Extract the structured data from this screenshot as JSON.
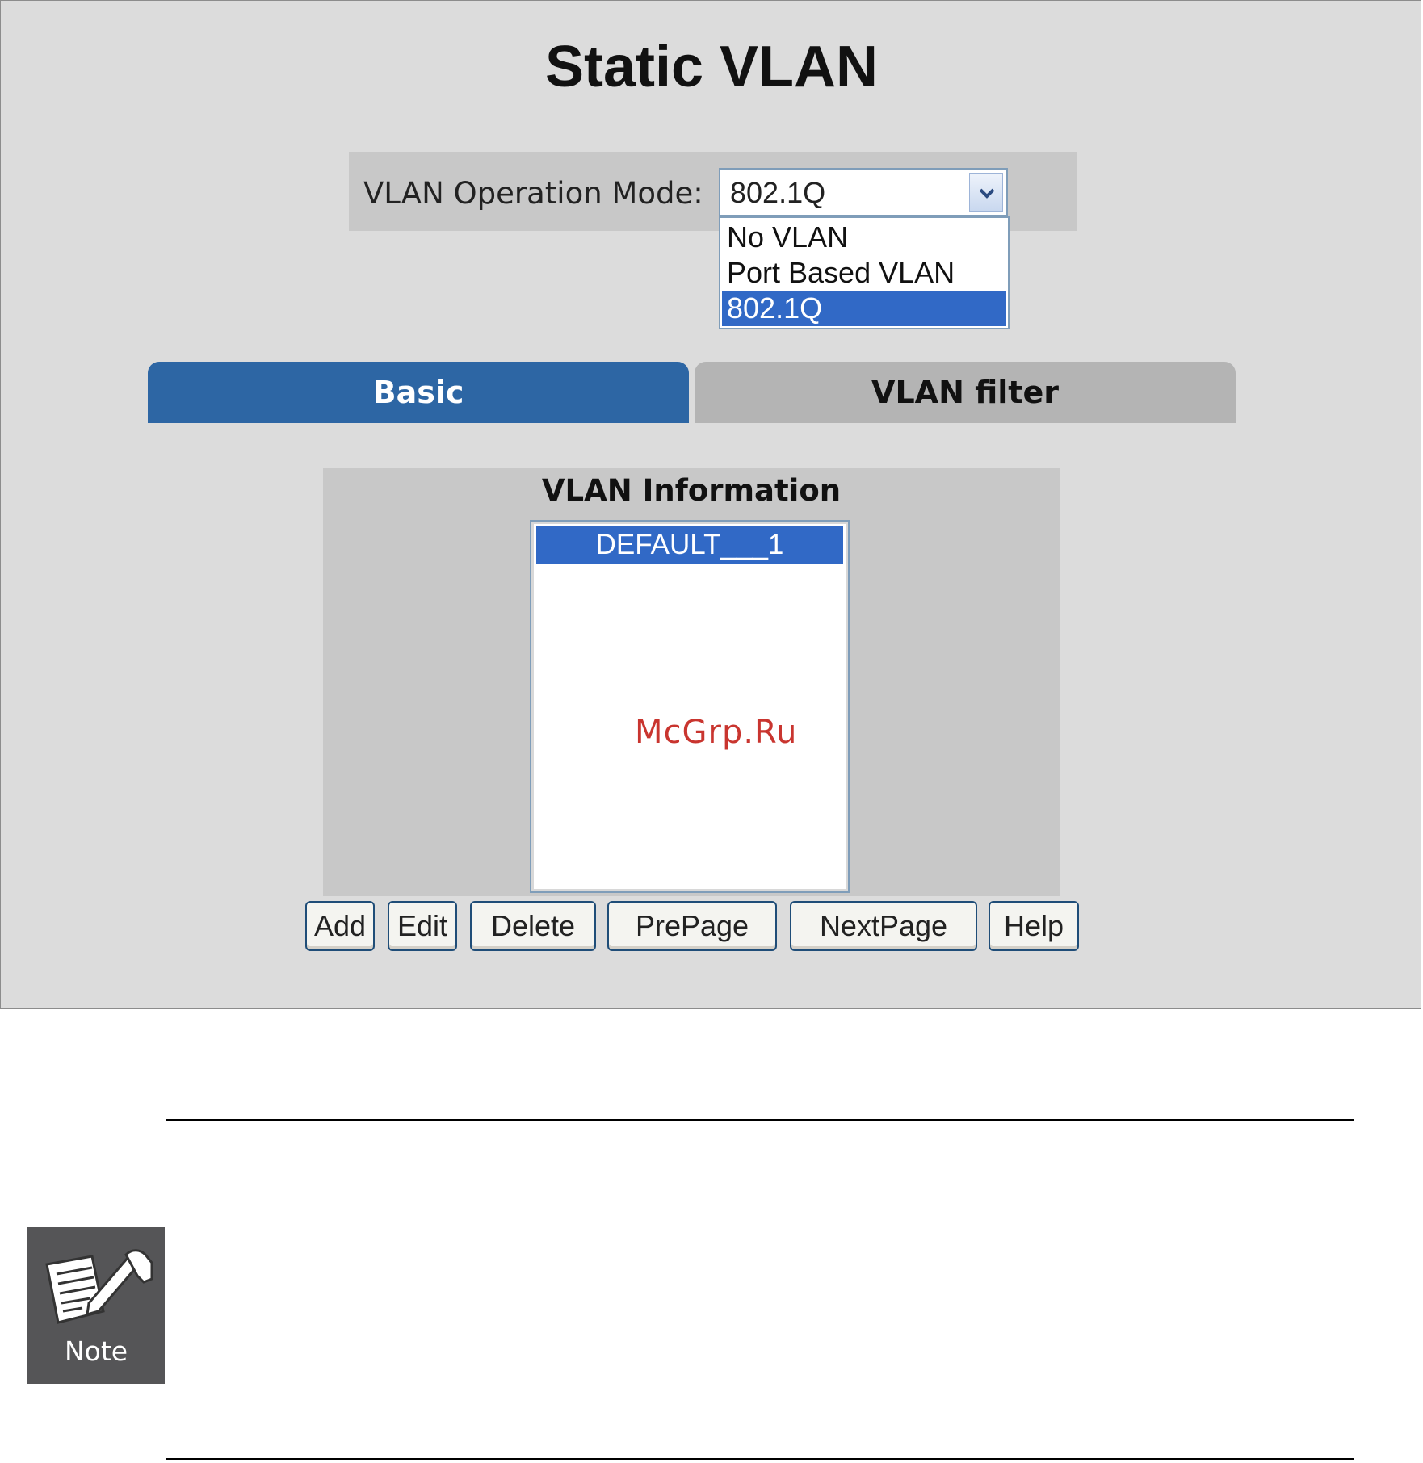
{
  "title": "Static VLAN",
  "mode": {
    "label": "VLAN Operation Mode:",
    "selected": "802.1Q",
    "options": [
      "No VLAN",
      "Port Based VLAN",
      "802.1Q"
    ]
  },
  "tabs": {
    "basic": "Basic",
    "filter": "VLAN filter"
  },
  "info": {
    "title": "VLAN Information",
    "items": [
      "DEFAULT___1"
    ]
  },
  "buttons": {
    "add": "Add",
    "edit": "Edit",
    "delete": "Delete",
    "prepage": "PrePage",
    "nextpage": "NextPage",
    "help": "Help"
  },
  "watermark": "McGrp.Ru",
  "note": {
    "label": "Note",
    "icon": "note-pad-pen-icon"
  },
  "colors": {
    "selection": "#3169c6",
    "tab_active": "#2d66a4",
    "tab_inactive": "#b4b4b4",
    "panel": "#dcdcdc",
    "watermark": "#c9352f"
  }
}
